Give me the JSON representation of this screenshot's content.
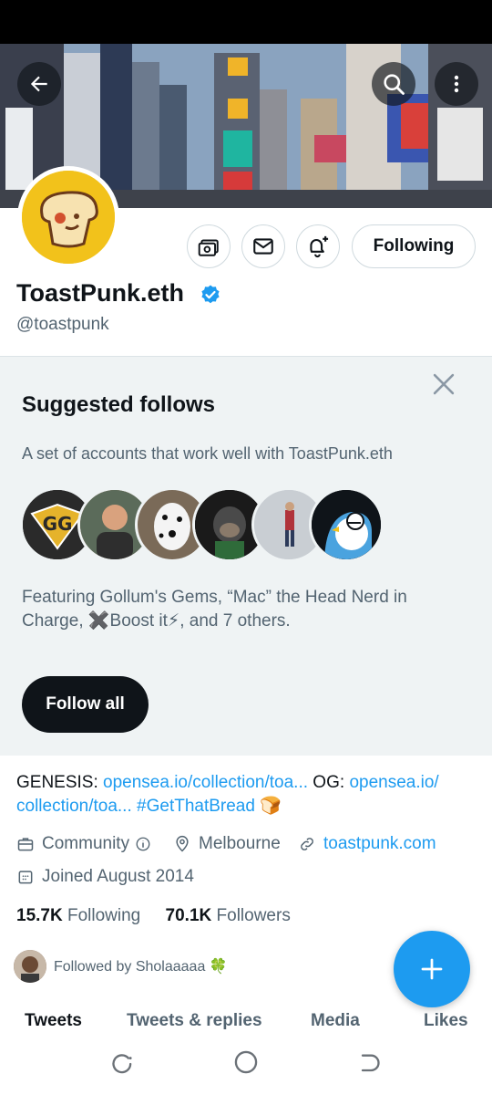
{
  "profile": {
    "display_name": "ToastPunk.eth",
    "handle": "@toastpunk",
    "following_button": "Following"
  },
  "suggested": {
    "title": "Suggested follows",
    "subtitle": "A set of accounts that work well with ToastPunk.eth",
    "featuring_line1": "Featuring Gollum's Gems, “Mac” the Head Nerd in",
    "featuring_line2": "Charge, ✖️Boost it⚡, and 7 others.",
    "follow_all": "Follow all"
  },
  "bio": {
    "prefix1": "GENESIS: ",
    "link1": "opensea.io/collection/toa...",
    "mid": " OG: ",
    "link2a": "opensea.io/",
    "link2b": "collection/toa...",
    "hashtag": " #GetThatBread",
    "emoji": " 🍞"
  },
  "meta": {
    "category": "Community",
    "location": "Melbourne",
    "website": "toastpunk.com",
    "joined": "Joined August 2014"
  },
  "stats": {
    "following_count": "15.7K",
    "following_label": "Following",
    "followers_count": "70.1K",
    "followers_label": "Followers"
  },
  "followed_by": "Followed by Sholaaaaa 🍀",
  "tabs": [
    "Tweets",
    "Tweets & replies",
    "Media",
    "Likes"
  ],
  "colors": {
    "accent": "#1d9bf0",
    "text": "#0f1419",
    "muted": "#536471",
    "panel": "#eff3f4"
  }
}
